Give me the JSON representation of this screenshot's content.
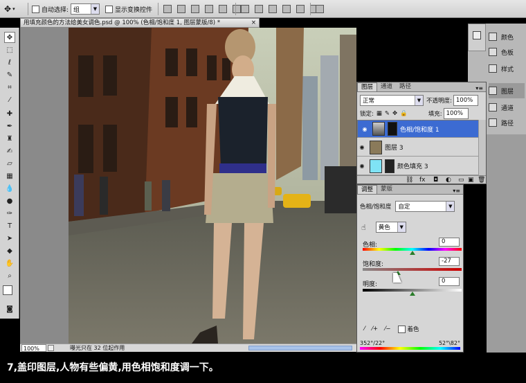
{
  "optionbar": {
    "auto_select_label": "自动选择:",
    "auto_select_value": "组",
    "show_transform_label": "显示变换控件"
  },
  "document": {
    "title": "用填充颜色的方法给美女调色.psd @ 100% (色相/饱和度 1, 图层蒙版/8) *",
    "close": "×",
    "zoom": "100%",
    "status": "曝光只在 32 位起作用"
  },
  "dock": {
    "items": [
      "颜色",
      "色板",
      "样式",
      "图层",
      "通道",
      "路径"
    ]
  },
  "layers_panel": {
    "tabs": [
      "图层",
      "通道",
      "路径"
    ],
    "blend_mode": "正常",
    "opacity_label": "不透明度:",
    "opacity_value": "100%",
    "lock_label": "锁定:",
    "fill_label": "填充:",
    "fill_value": "100%",
    "layers": [
      {
        "name": "色相/饱和度 1",
        "selected": true
      },
      {
        "name": "图层 3",
        "selected": false
      },
      {
        "name": "颜色填充 3",
        "selected": false
      }
    ]
  },
  "adjustments_panel": {
    "tabs": [
      "调整",
      "蒙版"
    ],
    "title": "色相/饱和度",
    "preset": "自定",
    "channel": "黄色",
    "hue_label": "色相:",
    "hue_value": "0",
    "saturation_label": "饱和度:",
    "saturation_value": "-27",
    "lightness_label": "明度:",
    "lightness_value": "0",
    "colorize_label": "着色",
    "range_left": "352°/22°",
    "range_right": "52°\\82°"
  },
  "caption": "7,盖印图层,人物有些偏黄,用色相饱和度调一下。",
  "colors": {
    "selection": "#3c6bd2",
    "fill_layer_swatch": "#7fe3f5"
  }
}
